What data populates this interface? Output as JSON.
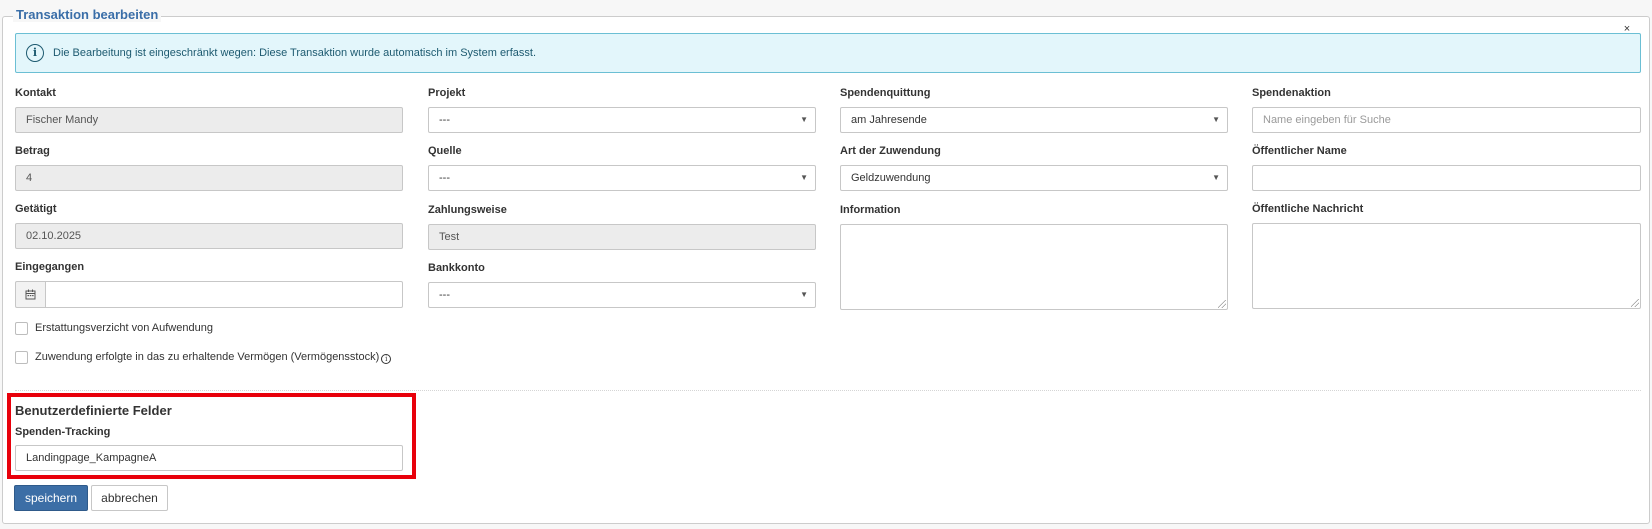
{
  "form": {
    "legend": "Transaktion bearbeiten",
    "close_glyph": "×"
  },
  "alert": {
    "icon": "info-circle-icon",
    "icon_glyph": "i",
    "text": "Die Bearbeitung ist eingeschränkt wegen: Diese Transaktion wurde automatisch im System erfasst."
  },
  "fields": {
    "kontakt": {
      "label": "Kontakt",
      "value": "Fischer Mandy"
    },
    "betrag": {
      "label": "Betrag",
      "value": "4"
    },
    "getaetigt": {
      "label": "Getätigt",
      "value": "02.10.2025"
    },
    "eingegangen": {
      "label": "Eingegangen",
      "value": "",
      "icon": "calendar-icon"
    },
    "projekt": {
      "label": "Projekt",
      "value": "---"
    },
    "quelle": {
      "label": "Quelle",
      "value": "---"
    },
    "zahlungsweise": {
      "label": "Zahlungsweise",
      "value": "Test"
    },
    "bankkonto": {
      "label": "Bankkonto",
      "value": "---"
    },
    "spendenquittung": {
      "label": "Spendenquittung",
      "value": "am Jahresende"
    },
    "art_der_zuwendung": {
      "label": "Art der Zuwendung",
      "value": "Geldzuwendung"
    },
    "information": {
      "label": "Information",
      "value": ""
    },
    "spendenaktion": {
      "label": "Spendenaktion",
      "placeholder": "Name eingeben für Suche"
    },
    "oeffentlicher_name": {
      "label": "Öffentlicher Name",
      "value": ""
    },
    "oeffentliche_nachricht": {
      "label": "Öffentliche Nachricht",
      "value": ""
    }
  },
  "checkboxes": {
    "erstattungsverzicht": {
      "label": "Erstattungsverzicht von Aufwendung",
      "checked": false
    },
    "vermoegensstock": {
      "label": "Zuwendung erfolgte in das zu erhaltende Vermögen (Vermögensstock)",
      "checked": false,
      "info_glyph": "i"
    }
  },
  "custom_fields": {
    "title": "Benutzerdefinierte Felder",
    "spenden_tracking": {
      "label": "Spenden-Tracking",
      "value": "Landingpage_KampagneA"
    }
  },
  "actions": {
    "save_label": "speichern",
    "cancel_label": "abbrechen"
  },
  "colors": {
    "accent": "#3c6ea6",
    "alert_bg": "#e3f6fb",
    "alert_border": "#6bbfd4",
    "highlight": "#e8000b",
    "readonly_bg": "#ececec"
  }
}
